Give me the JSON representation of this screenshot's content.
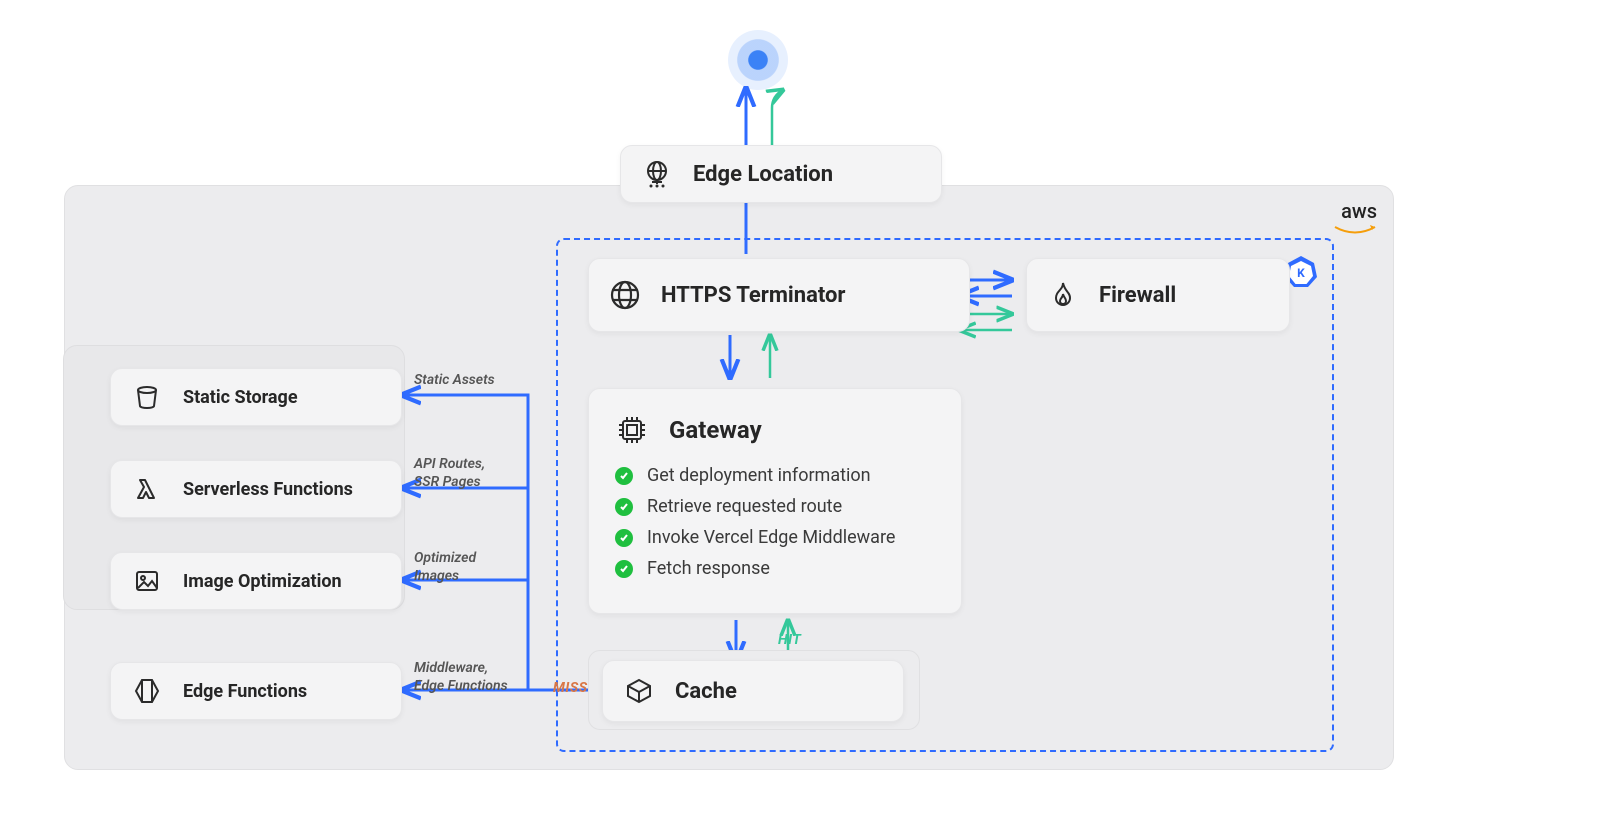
{
  "provider": {
    "label": "aws"
  },
  "nodes": {
    "edge_location": "Edge Location",
    "https_terminator": "HTTPS Terminator",
    "firewall": "Firewall",
    "gateway": "Gateway",
    "cache": "Cache",
    "static_storage": "Static Storage",
    "serverless_functions": "Serverless Functions",
    "image_optimization": "Image Optimization",
    "edge_functions": "Edge Functions"
  },
  "gateway_steps": [
    "Get deployment information",
    "Retrieve requested route",
    "Invoke Vercel Edge Middleware",
    "Fetch response"
  ],
  "edge_labels": {
    "static": "Static Assets",
    "api": "API Routes,\nSSR Pages",
    "img": "Optimized\nImages",
    "mw": "Middleware,\nEdge Functions",
    "miss": "MISS",
    "hit": "HIT"
  }
}
